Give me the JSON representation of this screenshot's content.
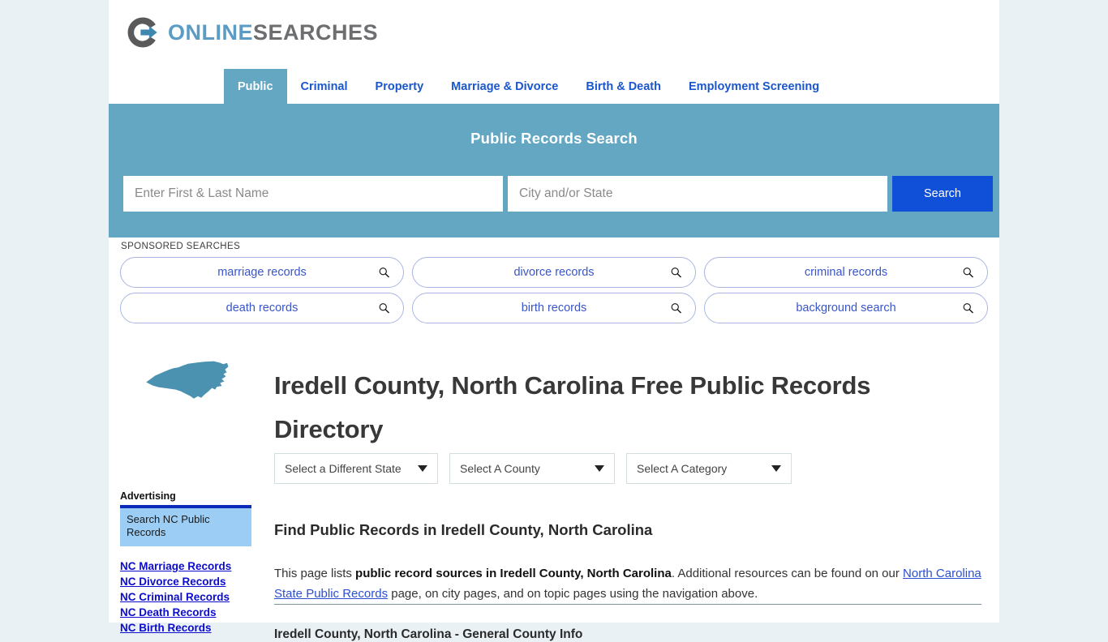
{
  "brand": {
    "name_part1": "ONLINE",
    "name_part2": "SEARCHES",
    "logo_icon": "circle-arrow-logo",
    "accent_blue": "#5b9cc4",
    "accent_gray": "#6d6e70"
  },
  "nav": {
    "items": [
      {
        "label": "Public",
        "active": true
      },
      {
        "label": "Criminal",
        "active": false
      },
      {
        "label": "Property",
        "active": false
      },
      {
        "label": "Marriage & Divorce",
        "active": false
      },
      {
        "label": "Birth & Death",
        "active": false
      },
      {
        "label": "Employment Screening",
        "active": false
      }
    ]
  },
  "search_band": {
    "title": "Public Records Search",
    "name_value": "",
    "name_placeholder": "Enter First & Last Name",
    "city_value": "",
    "city_placeholder": "City and/or State",
    "button_label": "Search",
    "band_color": "#63a7c2",
    "button_color": "#1050d8"
  },
  "sponsored": {
    "label": "SPONSORED SEARCHES",
    "items": [
      {
        "label": "marriage records",
        "icon": "search-icon"
      },
      {
        "label": "divorce records",
        "icon": "search-icon"
      },
      {
        "label": "criminal records",
        "icon": "search-icon"
      },
      {
        "label": "death records",
        "icon": "search-icon"
      },
      {
        "label": "birth records",
        "icon": "search-icon"
      },
      {
        "label": "background search",
        "icon": "search-icon"
      }
    ]
  },
  "main": {
    "state_map_icon": "north-carolina-map",
    "state_map_color": "#4b92b0",
    "page_title": "Iredell County, North Carolina Free Public Records Directory",
    "selects": [
      {
        "label": "Select a Different State"
      },
      {
        "label": "Select A County"
      },
      {
        "label": "Select A Category"
      }
    ],
    "section_heading": "Find Public Records in Iredell County, North Carolina",
    "paragraph": {
      "text_1": "This page lists ",
      "bold_1": "public record sources in Iredell County, North Carolina",
      "text_2": ". Additional resources can be found on our ",
      "link_1": "North Carolina State Public Records",
      "text_3": " page, on city pages, and on topic pages using the navigation above."
    },
    "subsection_heading": "Iredell County, North Carolina - General County Info"
  },
  "sidebar": {
    "heading": "Advertising",
    "ad_box_text": "Search NC Public Records",
    "links": [
      {
        "label": "NC Marriage Records"
      },
      {
        "label": "NC Divorce Records"
      },
      {
        "label": "NC Criminal Records"
      },
      {
        "label": "NC Death Records"
      },
      {
        "label": "NC Birth Records"
      }
    ]
  }
}
